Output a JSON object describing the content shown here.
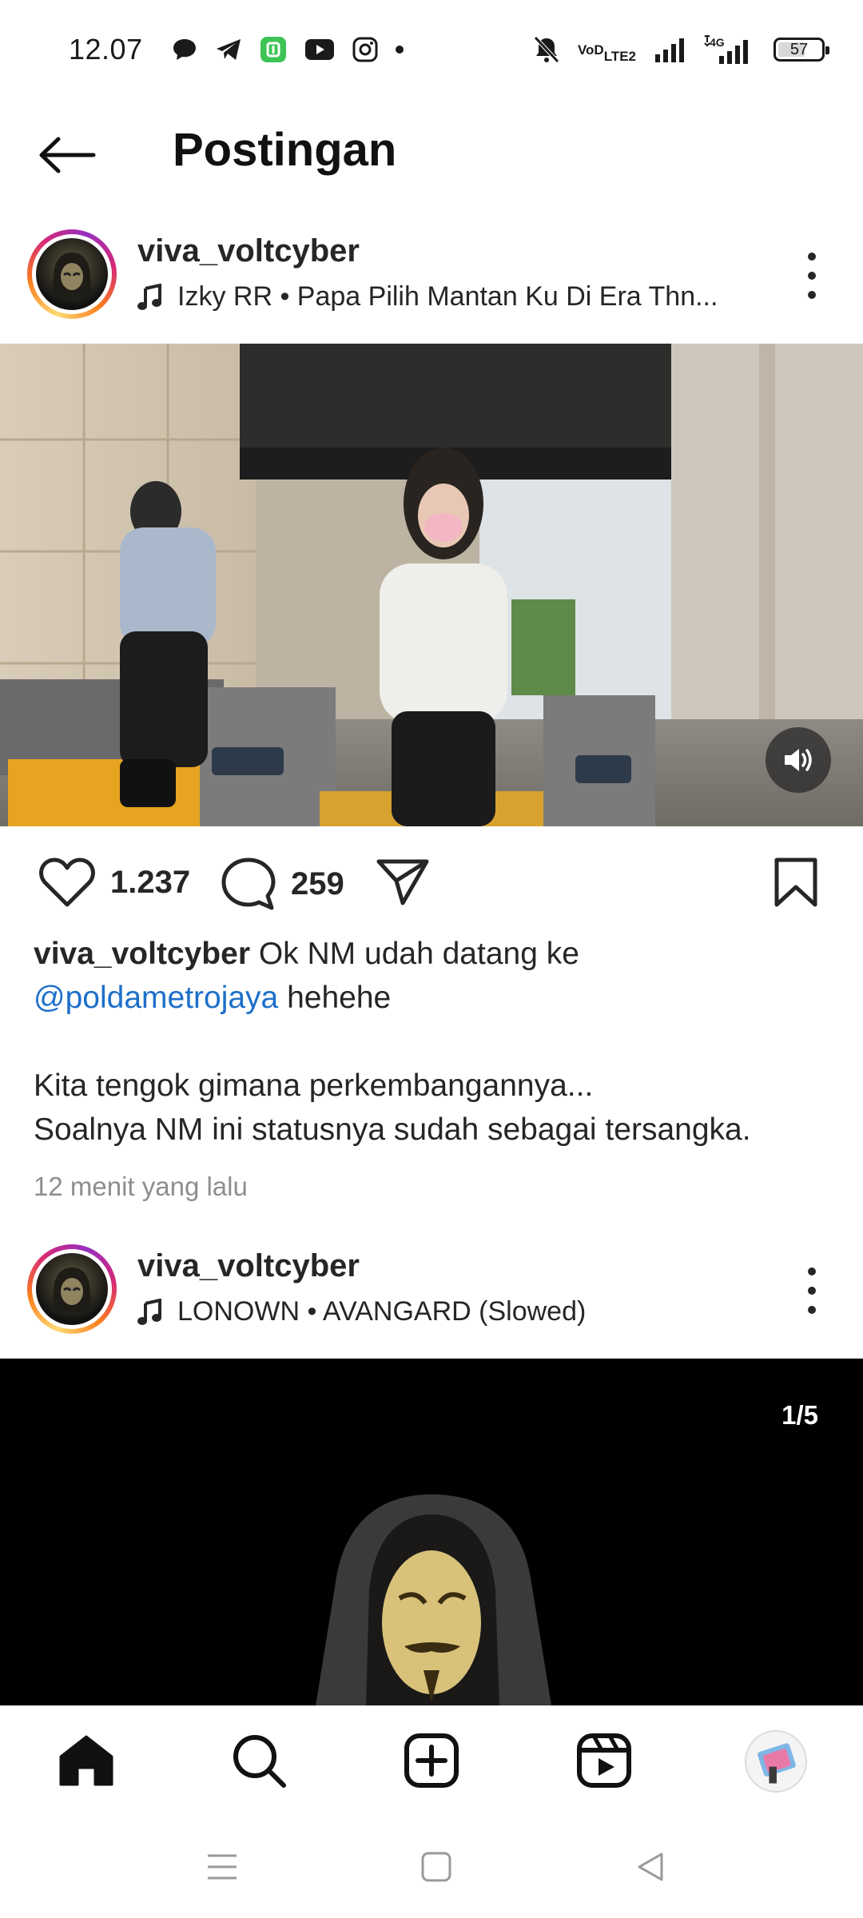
{
  "status_bar": {
    "time": "12.07",
    "network_label": "LTE",
    "volte_label": "VoLTE",
    "network_4g": "4G",
    "battery": "57",
    "notification_icons": [
      "chat-bubble-icon",
      "telegram-icon",
      "app-icon",
      "youtube-icon",
      "instagram-icon",
      "more-dot-icon"
    ],
    "status_icons": [
      "bell-muted-icon",
      "volte-icon",
      "signal-icon",
      "signal-4g-icon",
      "battery-icon"
    ]
  },
  "header": {
    "title": "Postingan",
    "back_icon": "arrow-left-icon"
  },
  "posts": [
    {
      "username": "viva_voltcyber",
      "music": "Izky RR • Papa Pilih Mantan Ku Di Era Thn...",
      "likes": "1.237",
      "comments": "259",
      "caption_user": "viva_voltcyber",
      "caption_line1": " Ok NM udah datang ke",
      "caption_mention": "@poldametrojaya",
      "caption_line2": " hehehe",
      "caption_line3": "Kita tengok gimana perkembangannya...",
      "caption_line4": "Soalnya NM ini statusnya sudah sebagai tersangka.",
      "timestamp": "12 menit yang lalu"
    },
    {
      "username": "viva_voltcyber",
      "music": "LONOWN • AVANGARD (Slowed)",
      "carousel_counter": "1/5"
    }
  ],
  "tabbar": {
    "items": [
      "home-icon",
      "search-icon",
      "create-post-icon",
      "reels-icon",
      "profile-avatar"
    ]
  },
  "system_nav": {
    "items": [
      "menu-icon",
      "home-square-icon",
      "back-triangle-icon"
    ]
  },
  "colors": {
    "text": "#262626",
    "secondary_text": "#8e8e8e",
    "link": "#1d6fc9",
    "story_ring": [
      "#feda75",
      "#fa7e1e",
      "#d62976",
      "#962fbf"
    ]
  }
}
